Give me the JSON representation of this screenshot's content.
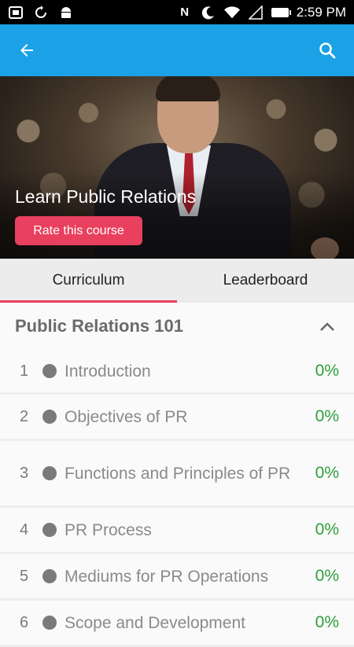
{
  "status_bar": {
    "time": "2:59 PM",
    "nfc": "N",
    "icons": [
      "screenshot-icon",
      "sync-icon",
      "android-icon",
      "nfc-icon",
      "moon-icon",
      "wifi-icon",
      "signal-icon",
      "battery-icon"
    ]
  },
  "colors": {
    "app_bar": "#1ba2e6",
    "accent": "#e8405e",
    "progress_green": "#2e9e3a"
  },
  "hero": {
    "title": "Learn Public Relations",
    "rate_label": "Rate this course"
  },
  "tabs": [
    {
      "label": "Curriculum",
      "active": true
    },
    {
      "label": "Leaderboard",
      "active": false
    }
  ],
  "section": {
    "title": "Public Relations 101",
    "lessons": [
      {
        "num": "1",
        "title": "Introduction",
        "progress": "0%"
      },
      {
        "num": "2",
        "title": "Objectives of PR",
        "progress": "0%"
      },
      {
        "num": "3",
        "title": "Functions and Principles of PR",
        "progress": "0%"
      },
      {
        "num": "4",
        "title": "PR Process",
        "progress": "0%"
      },
      {
        "num": "5",
        "title": "Mediums for PR Operations",
        "progress": "0%"
      },
      {
        "num": "6",
        "title": "Scope and Development",
        "progress": "0%"
      }
    ]
  }
}
